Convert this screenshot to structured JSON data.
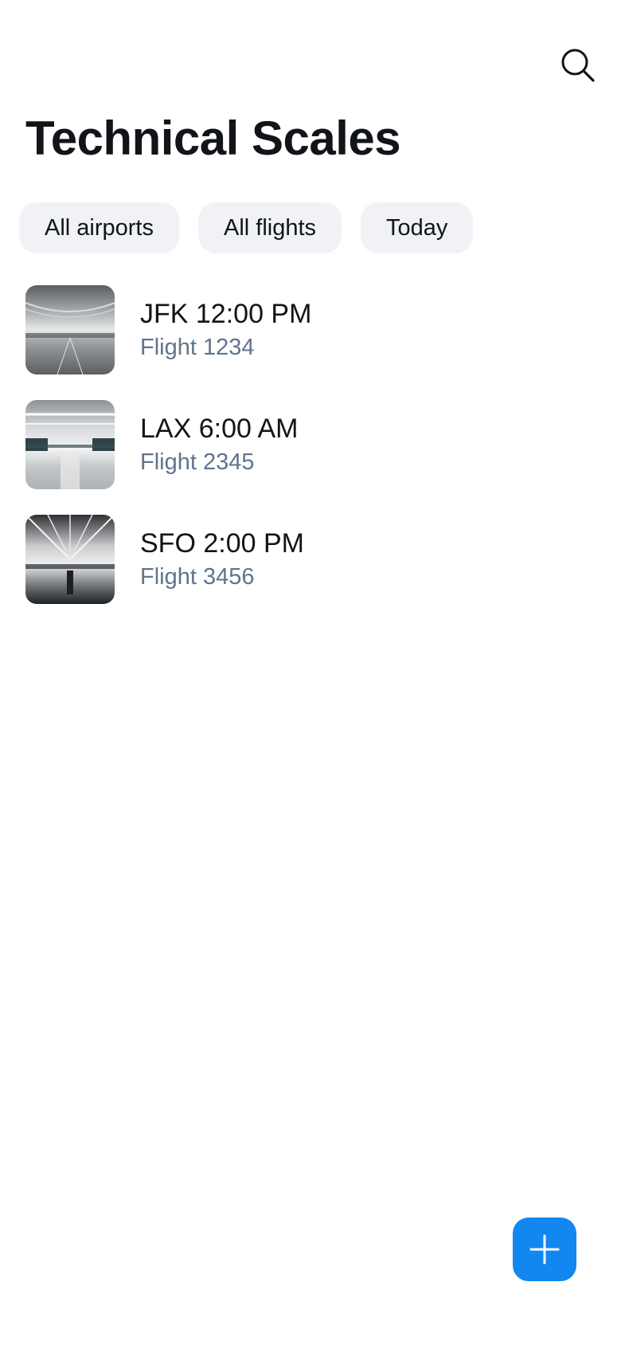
{
  "header": {
    "title": "Technical Scales",
    "search_icon": "search-icon"
  },
  "filters": [
    {
      "label": "All airports"
    },
    {
      "label": "All flights"
    },
    {
      "label": "Today"
    }
  ],
  "flights": [
    {
      "title": "JFK 12:00 PM",
      "subtitle": "Flight 1234",
      "image": "airport-terminal-photo"
    },
    {
      "title": "LAX 6:00 AM",
      "subtitle": "Flight 2345",
      "image": "airport-terminal-photo"
    },
    {
      "title": "SFO 2:00 PM",
      "subtitle": "Flight 3456",
      "image": "airport-terminal-photo"
    }
  ],
  "fab": {
    "icon": "plus-icon",
    "color": "#1287f0"
  },
  "colors": {
    "chip_background": "#f0f2f5",
    "secondary_text": "#60758a",
    "primary_text": "#111418"
  }
}
